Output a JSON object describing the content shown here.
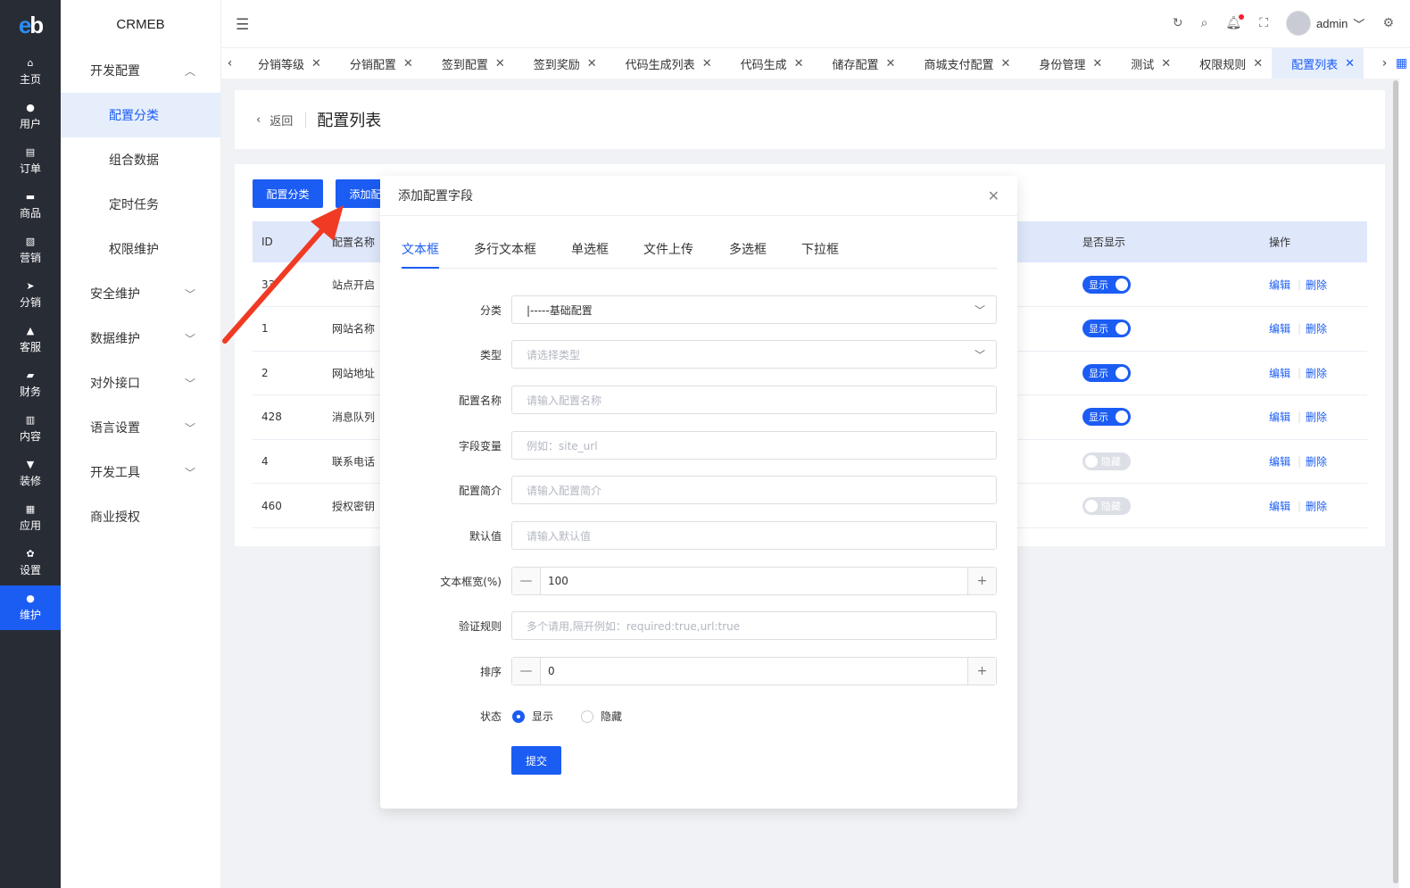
{
  "rail": {
    "logo": "eb",
    "items": [
      {
        "label": "主页",
        "icon": "home-icon",
        "glyph": "⌂"
      },
      {
        "label": "用户",
        "icon": "user-icon",
        "glyph": "●"
      },
      {
        "label": "订单",
        "icon": "order-icon",
        "glyph": "▤"
      },
      {
        "label": "商品",
        "icon": "goods-icon",
        "glyph": "▬"
      },
      {
        "label": "营销",
        "icon": "marketing-icon",
        "glyph": "▧"
      },
      {
        "label": "分销",
        "icon": "send-icon",
        "glyph": "➤"
      },
      {
        "label": "客服",
        "icon": "bell-icon",
        "glyph": "▲"
      },
      {
        "label": "财务",
        "icon": "wallet-icon",
        "glyph": "▰"
      },
      {
        "label": "内容",
        "icon": "content-icon",
        "glyph": "▥"
      },
      {
        "label": "装修",
        "icon": "brush-icon",
        "glyph": "▼"
      },
      {
        "label": "应用",
        "icon": "apps-icon",
        "glyph": "▦"
      },
      {
        "label": "设置",
        "icon": "gear-icon",
        "glyph": "✿"
      },
      {
        "label": "维护",
        "icon": "maintain-icon",
        "glyph": "●",
        "active": true
      }
    ]
  },
  "menu": {
    "title": "CRMEB",
    "group_dev": "开发配置",
    "sub_items": [
      "配置分类",
      "组合数据",
      "定时任务",
      "权限维护"
    ],
    "groups": [
      "安全维护",
      "数据维护",
      "对外接口",
      "语言设置",
      "开发工具"
    ],
    "last": "商业授权"
  },
  "header": {
    "user": "admin"
  },
  "tabs": [
    "分销等级",
    "分销配置",
    "签到配置",
    "签到奖励",
    "代码生成列表",
    "代码生成",
    "储存配置",
    "商城支付配置",
    "身份管理",
    "测试",
    "权限规则",
    "配置列表"
  ],
  "page": {
    "back": "返回",
    "title": "配置列表",
    "btn_category": "配置分类",
    "btn_add": "添加配置",
    "columns": {
      "id": "ID",
      "name": "配置名称",
      "show": "是否显示",
      "ops": "操作"
    },
    "rows": [
      {
        "id": "33",
        "name": "站点开启",
        "show": true
      },
      {
        "id": "1",
        "name": "网站名称",
        "show": true
      },
      {
        "id": "2",
        "name": "网站地址",
        "show": true
      },
      {
        "id": "428",
        "name": "消息队列",
        "show": true
      },
      {
        "id": "4",
        "name": "联系电话",
        "show": false
      },
      {
        "id": "460",
        "name": "授权密钥",
        "show": false
      }
    ],
    "show_on": "显示",
    "show_off": "隐藏",
    "edit": "编辑",
    "delete": "删除"
  },
  "modal": {
    "title": "添加配置字段",
    "tabs": [
      "文本框",
      "多行文本框",
      "单选框",
      "文件上传",
      "多选框",
      "下拉框"
    ],
    "fields": {
      "category_label": "分类",
      "category_value": "|-----基础配置",
      "type_label": "类型",
      "type_placeholder": "请选择类型",
      "name_label": "配置名称",
      "name_placeholder": "请输入配置名称",
      "var_label": "字段变量",
      "var_placeholder": "例如：site_url",
      "desc_label": "配置简介",
      "desc_placeholder": "请输入配置简介",
      "default_label": "默认值",
      "default_placeholder": "请输入默认值",
      "width_label": "文本框宽(%)",
      "width_value": "100",
      "rule_label": "验证规则",
      "rule_placeholder": "多个请用,隔开例如：required:true,url:true",
      "sort_label": "排序",
      "sort_value": "0",
      "status_label": "状态",
      "status_show": "显示",
      "status_hide": "隐藏"
    },
    "submit": "提交"
  },
  "colors": {
    "primary": "#1b5cf3",
    "rail_bg": "#282c34",
    "annotation": "#f03a24"
  }
}
